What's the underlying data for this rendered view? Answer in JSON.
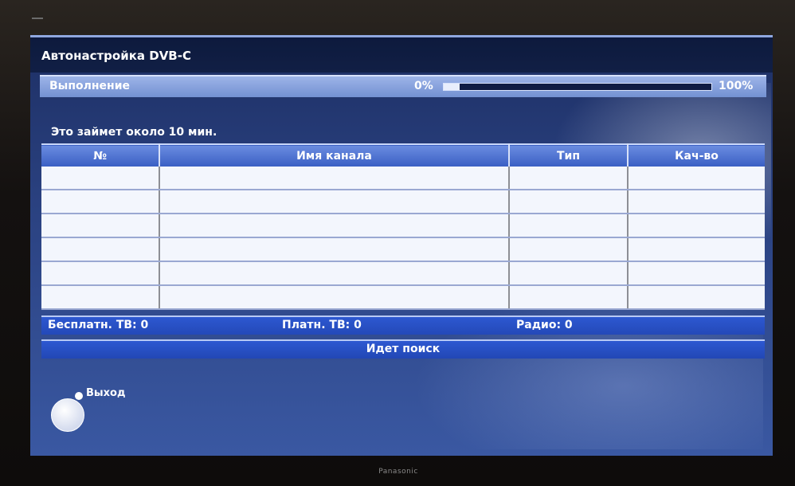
{
  "screen": {
    "title": "Автонастройка DVB-C",
    "progress": {
      "label": "Выполнение",
      "start_label": "0%",
      "end_label": "100%",
      "value_fraction": 0.06
    },
    "info": "Это займет около 10 мин.",
    "table": {
      "headers": [
        "№",
        "Имя канала",
        "Тип",
        "Кач-во"
      ],
      "rows": [
        [
          "",
          "",
          "",
          ""
        ],
        [
          "",
          "",
          "",
          ""
        ],
        [
          "",
          "",
          "",
          ""
        ],
        [
          "",
          "",
          "",
          ""
        ],
        [
          "",
          "",
          "",
          ""
        ],
        [
          "",
          "",
          "",
          ""
        ]
      ]
    },
    "stats": {
      "free_tv": "Бесплатн. ТВ: 0",
      "pay_tv": "Платн. ТВ: 0",
      "radio": "Радио: 0"
    },
    "status": "Идет поиск",
    "exit": {
      "label": "Выход",
      "icon": "remote-dpad-icon"
    }
  },
  "tv": {
    "brand": "Panasonic"
  },
  "colors": {
    "screen_background": "#2a4180",
    "header_bar": "#3a5fc4",
    "status_bar": "#2d58d1",
    "table_cell": "#f3f6fd"
  }
}
